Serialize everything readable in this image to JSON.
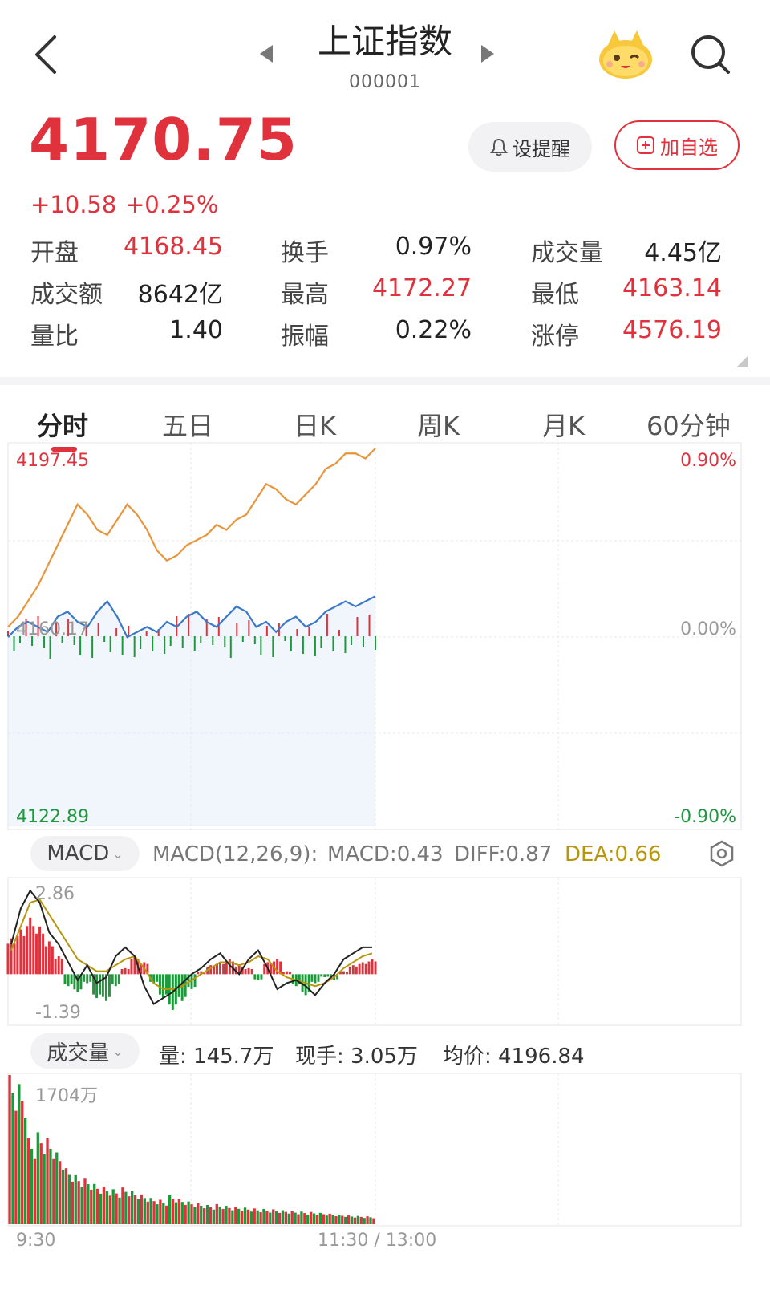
{
  "header": {
    "title": "上证指数",
    "code": "000001"
  },
  "quote": {
    "price": "4170.75",
    "change": "+10.58",
    "change_pct": "+0.25%",
    "alert_label": "设提醒",
    "add_label": "加自选"
  },
  "stats": [
    {
      "label": "开盘",
      "value": "4168.45",
      "tone": "red"
    },
    {
      "label": "换手",
      "value": "0.97%",
      "tone": "dark"
    },
    {
      "label": "成交量",
      "value": "4.45亿",
      "tone": "dark"
    },
    {
      "label": "成交额",
      "value": "8642亿",
      "tone": "dark"
    },
    {
      "label": "最高",
      "value": "4172.27",
      "tone": "red"
    },
    {
      "label": "最低",
      "value": "4163.14",
      "tone": "red"
    },
    {
      "label": "量比",
      "value": "1.40",
      "tone": "dark"
    },
    {
      "label": "振幅",
      "value": "0.22%",
      "tone": "dark"
    },
    {
      "label": "涨停",
      "value": "4576.19",
      "tone": "red"
    }
  ],
  "tabs": [
    "分时",
    "五日",
    "日K",
    "周K",
    "月K",
    "60分钟"
  ],
  "price_chart": {
    "y_max_label": "4197.45",
    "y_mid_label": "4160.17",
    "y_min_label": "4122.89",
    "pct_max_label": "0.90%",
    "pct_mid_label": "0.00%",
    "pct_min_label": "-0.90%"
  },
  "macd": {
    "selector": "MACD",
    "params": "MACD(12,26,9):",
    "macd": "MACD:0.43",
    "diff": "DIFF:0.87",
    "dea": "DEA:0.66",
    "top_label": "2.86",
    "bottom_label": "-1.39"
  },
  "volume": {
    "selector": "成交量",
    "qty": "量: 145.7万",
    "hand": "现手: 3.05万",
    "avg": "均价: 4196.84",
    "top_label": "1704万",
    "time_start": "9:30",
    "time_mid": "11:30 / 13:00"
  },
  "colors": {
    "up": "#e0323d",
    "down": "#1b9a3a",
    "price_line": "#e8953a",
    "avg_line": "#3a78c8",
    "dea_line": "#b8960c"
  },
  "chart_data": [
    {
      "type": "line",
      "title": "",
      "ylim": [
        4122.89,
        4197.45
      ],
      "x": [
        "9:30",
        "11:30 / 13:00"
      ],
      "series": [
        {
          "values": [
            4162,
            4164,
            4167,
            4170,
            4174,
            4178,
            4182,
            4186,
            4184,
            4181,
            4180,
            4183,
            4186,
            4184,
            4181,
            4177,
            4175,
            4176,
            4178,
            4179,
            4180,
            4182,
            4181,
            4183,
            4184,
            4187,
            4190,
            4189,
            4187,
            4186,
            4188,
            4190,
            4193,
            4194,
            4196,
            4196,
            4195,
            4197
          ]
        },
        {
          "values": [
            4160,
            4162,
            4163,
            4162,
            4161,
            4164,
            4165,
            4163,
            4162,
            4165,
            4167,
            4164,
            4160,
            4161,
            4162,
            4161,
            4163,
            4162,
            4164,
            4165,
            4163,
            4162,
            4164,
            4166,
            4165,
            4162,
            4163,
            4161,
            4163,
            4164,
            4162,
            4163,
            4165,
            4166,
            4167,
            4166,
            4167,
            4168
          ]
        }
      ]
    },
    {
      "type": "bar",
      "title": "",
      "ylim": [
        -1.39,
        2.86
      ],
      "series": [
        {
          "name": "MACD",
          "values": [
            1.2,
            1.5,
            1.9,
            1.6,
            1.1,
            0.6,
            -0.4,
            -0.6,
            -0.3,
            -0.8,
            -0.9,
            -0.4,
            0.2,
            0.6,
            0.4,
            -0.3,
            -0.8,
            -1.2,
            -0.9,
            -0.5,
            0.1,
            0.3,
            0.4,
            0.5,
            0.3,
            0.2,
            -0.2,
            0.4,
            0.5,
            0.1,
            -0.4,
            -0.7,
            -0.3,
            -0.1,
            -0.2,
            0.1,
            0.3,
            0.4,
            0.5
          ]
        },
        {
          "name": "DIFF",
          "values": [
            1.0,
            2.2,
            2.8,
            2.4,
            1.4,
            1.0,
            0.4,
            -0.2,
            0.3,
            -0.3,
            -0.1,
            0.6,
            0.9,
            0.6,
            -0.4,
            -1.0,
            -0.8,
            -0.6,
            -0.3,
            0.0,
            0.2,
            0.5,
            0.7,
            0.3,
            0.0,
            0.5,
            0.8,
            0.2,
            -0.5,
            -0.3,
            -0.2,
            -0.4,
            -0.7,
            -0.3,
            0.0,
            0.5,
            0.7,
            0.9,
            0.9
          ]
        },
        {
          "name": "DEA",
          "values": [
            0.8,
            1.6,
            2.4,
            2.5,
            2.0,
            1.5,
            1.0,
            0.5,
            0.3,
            0.1,
            0.1,
            0.3,
            0.5,
            0.6,
            0.2,
            -0.3,
            -0.5,
            -0.5,
            -0.4,
            -0.2,
            0.0,
            0.2,
            0.4,
            0.4,
            0.3,
            0.4,
            0.6,
            0.5,
            0.1,
            -0.1,
            -0.2,
            -0.3,
            -0.4,
            -0.3,
            -0.1,
            0.2,
            0.4,
            0.6,
            0.7
          ]
        }
      ]
    },
    {
      "type": "bar",
      "title": "",
      "ylim": [
        0,
        1704
      ],
      "series": [
        {
          "name": "成交量",
          "values": [
            1704,
            1600,
            980,
            1050,
            980,
            820,
            640,
            560,
            520,
            460,
            430,
            400,
            420,
            380,
            340,
            300,
            280,
            330,
            290,
            260,
            240,
            220,
            230,
            210,
            200,
            190,
            180,
            175,
            170,
            160,
            150,
            145,
            140,
            130,
            120,
            110,
            100,
            95,
            90
          ]
        }
      ]
    }
  ]
}
